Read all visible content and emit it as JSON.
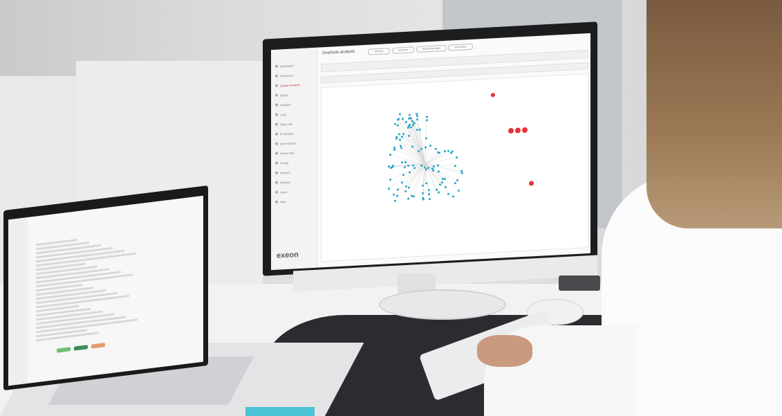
{
  "monitor_app": {
    "brand": "exeon",
    "page_title": "Overlook analysis",
    "header_tabs": [
      "Overview",
      "Detections"
    ],
    "header_buttons": [
      "Explore data graph",
      "Show details"
    ],
    "sidebar_items": [
      "Dashboard",
      "Detections",
      "Cluster Analysis",
      "Graph",
      "Analytics",
      "Logs",
      "Data Lake",
      "IP Analysis",
      "Net Analytics",
      "Threat Intel",
      "Tuning",
      "Sensors",
      "Settings",
      "Users",
      "Help"
    ]
  },
  "colors": {
    "node_blue": "#29a6c8",
    "node_red": "#e2343b",
    "brand_grey": "#5a5a5a"
  }
}
